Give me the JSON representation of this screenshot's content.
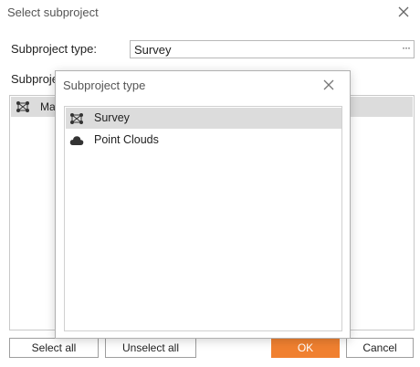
{
  "dialog": {
    "title": "Select subproject",
    "subproject_type_label": "Subproject type:",
    "subproject_type_value": "Survey",
    "browse_glyph": "···",
    "subprojects_label_partial": "Subproje",
    "list": [
      {
        "label_partial": "Ma",
        "icon": "survey-network-icon",
        "selected": true
      }
    ],
    "buttons": {
      "select_all": "Select all",
      "unselect_all": "Unselect all",
      "ok": "OK",
      "cancel": "Cancel"
    }
  },
  "popup": {
    "title": "Subproject type",
    "items": [
      {
        "label": "Survey",
        "icon": "survey-network-icon",
        "selected": true
      },
      {
        "label": "Point Clouds",
        "icon": "cloud-icon",
        "selected": false
      }
    ]
  },
  "colors": {
    "accent": "#f08030",
    "selection": "#dcdcdc"
  }
}
